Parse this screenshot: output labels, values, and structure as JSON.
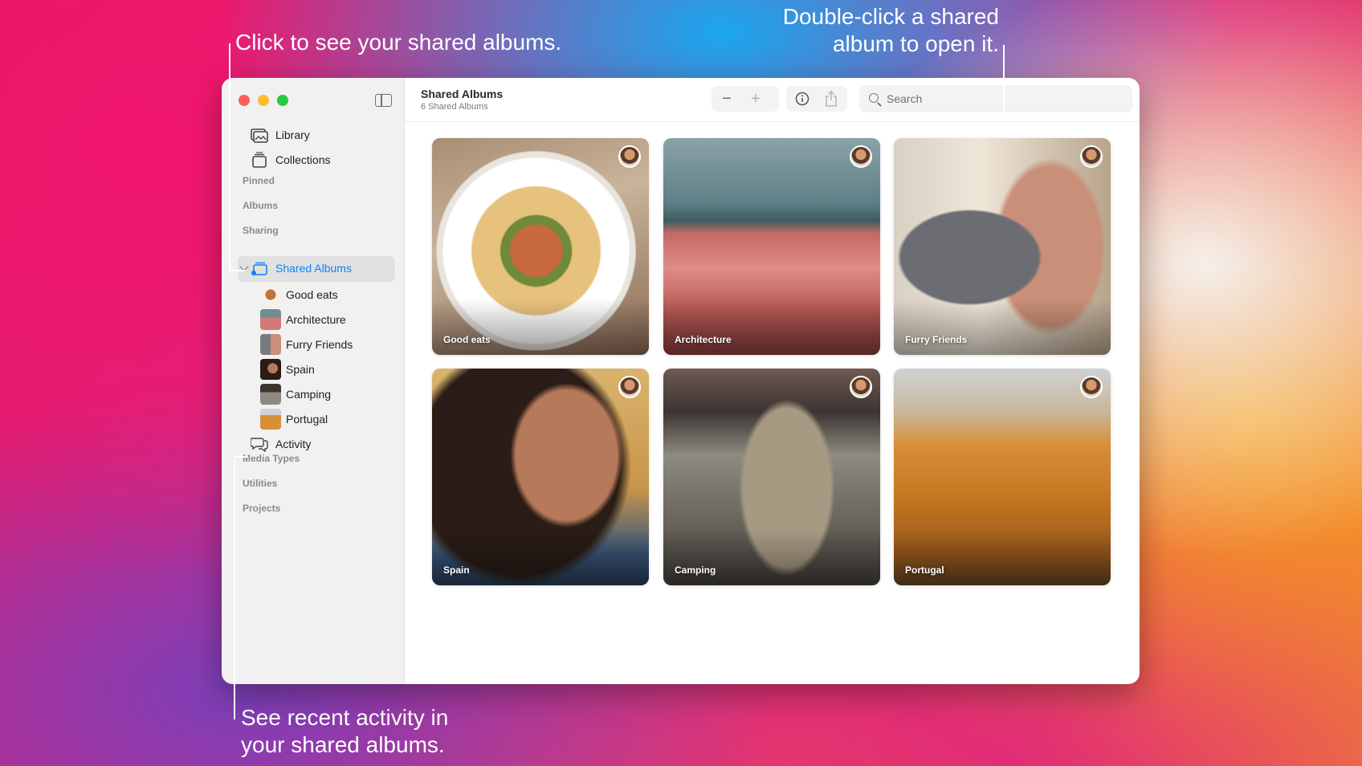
{
  "callouts": {
    "shared_albums": "Click to see your shared albums.",
    "open_album_line1": "Double-click a shared",
    "open_album_line2": "album to open it.",
    "activity_line1": "See recent activity in",
    "activity_line2": "your shared albums."
  },
  "sidebar": {
    "top_items": [
      {
        "label": "Library",
        "icon": "photo-library-icon"
      },
      {
        "label": "Collections",
        "icon": "collections-icon"
      }
    ],
    "sections": {
      "pinned": "Pinned",
      "albums": "Albums",
      "sharing": "Sharing",
      "media_types": "Media Types",
      "utilities": "Utilities",
      "projects": "Projects"
    },
    "shared_albums_label": "Shared Albums",
    "shared_albums_children": [
      {
        "label": "Good eats"
      },
      {
        "label": "Architecture"
      },
      {
        "label": "Furry Friends"
      },
      {
        "label": "Spain"
      },
      {
        "label": "Camping"
      },
      {
        "label": "Portugal"
      }
    ],
    "activity_label": "Activity"
  },
  "toolbar": {
    "title": "Shared Albums",
    "subtitle": "6 Shared Albums",
    "zoom_out": "−",
    "zoom_in": "+",
    "search_placeholder": "Search"
  },
  "grid": {
    "albums": [
      {
        "label": "Good eats"
      },
      {
        "label": "Architecture"
      },
      {
        "label": "Furry Friends"
      },
      {
        "label": "Spain"
      },
      {
        "label": "Camping"
      },
      {
        "label": "Portugal"
      }
    ]
  },
  "colors": {
    "accent": "#0a84ff",
    "close": "#fe5f57",
    "minimize": "#febc2e",
    "zoom": "#28c840"
  }
}
